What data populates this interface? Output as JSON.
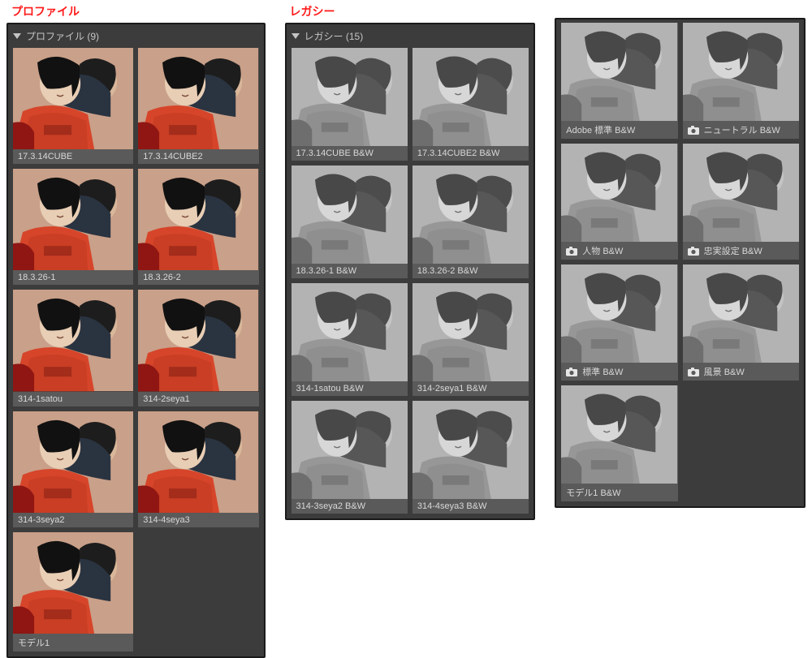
{
  "sections": {
    "profile": {
      "external_label": "プロファイル",
      "header": "プロファイル (9)"
    },
    "legacy": {
      "external_label": "レガシー",
      "header": "レガシー (15)"
    }
  },
  "profile_items": [
    {
      "label": "17.3.14CUBE",
      "bw": false,
      "cam": false
    },
    {
      "label": "17.3.14CUBE2",
      "bw": false,
      "cam": false
    },
    {
      "label": "18.3.26-1",
      "bw": false,
      "cam": false
    },
    {
      "label": "18.3.26-2",
      "bw": false,
      "cam": false
    },
    {
      "label": "314-1satou",
      "bw": false,
      "cam": false
    },
    {
      "label": "314-2seya1",
      "bw": false,
      "cam": false
    },
    {
      "label": "314-3seya2",
      "bw": false,
      "cam": false
    },
    {
      "label": "314-4seya3",
      "bw": false,
      "cam": false
    },
    {
      "label": "モデル1",
      "bw": false,
      "cam": false
    }
  ],
  "legacy_items_col2": [
    {
      "label": "17.3.14CUBE B&W",
      "bw": true,
      "cam": false
    },
    {
      "label": "17.3.14CUBE2 B&W",
      "bw": true,
      "cam": false
    },
    {
      "label": "18.3.26-1 B&W",
      "bw": true,
      "cam": false
    },
    {
      "label": "18.3.26-2 B&W",
      "bw": true,
      "cam": false
    },
    {
      "label": "314-1satou B&W",
      "bw": true,
      "cam": false
    },
    {
      "label": "314-2seya1 B&W",
      "bw": true,
      "cam": false
    },
    {
      "label": "314-3seya2 B&W",
      "bw": true,
      "cam": false
    },
    {
      "label": "314-4seya3 B&W",
      "bw": true,
      "cam": false
    }
  ],
  "legacy_items_col3": [
    {
      "label": "Adobe 標準 B&W",
      "bw": true,
      "cam": false
    },
    {
      "label": "ニュートラル B&W",
      "bw": true,
      "cam": true
    },
    {
      "label": "人物 B&W",
      "bw": true,
      "cam": true
    },
    {
      "label": "忠実設定 B&W",
      "bw": true,
      "cam": true
    },
    {
      "label": "標準 B&W",
      "bw": true,
      "cam": true
    },
    {
      "label": "風景 B&W",
      "bw": true,
      "cam": true
    },
    {
      "label": "モデル1 B&W",
      "bw": true,
      "cam": false
    }
  ]
}
